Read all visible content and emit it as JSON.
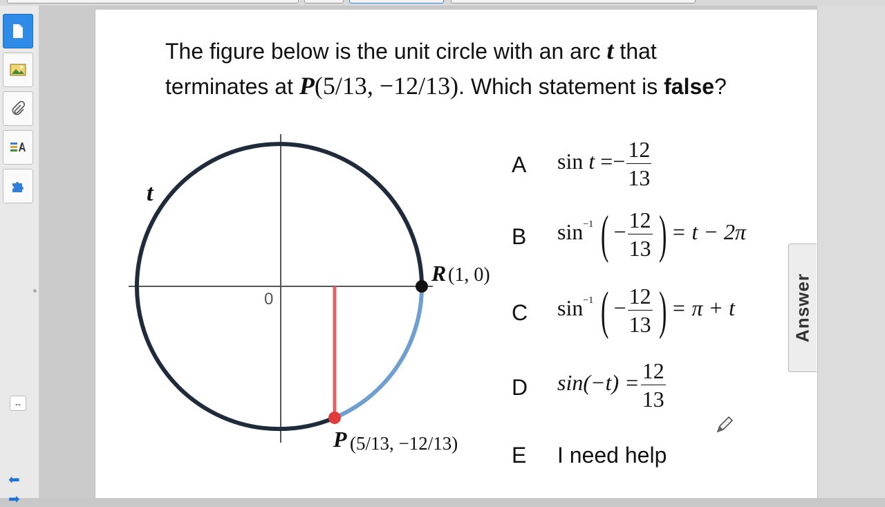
{
  "question": {
    "part1": "The figure below is the unit circle with an arc ",
    "arc_var": "t",
    "part2": " that",
    "part3": "terminates at ",
    "point_var": "P",
    "point_coords": "(5/13, −12/13)",
    "part4": ". Which statement is ",
    "keyword": "false",
    "part5": "?"
  },
  "figure": {
    "origin_label": "0",
    "arc_label": "t",
    "r_var": "R",
    "r_coords": "(1, 0)",
    "p_var": "P",
    "p_coords": "(5/13, −12/13)",
    "colors": {
      "circle": "#1f2a3a",
      "arc": "#6f9fd0",
      "segment": "#e06464",
      "point_r": "#111111",
      "point_p": "#e03c3c"
    }
  },
  "choices": [
    {
      "letter": "A",
      "lhs": "sin",
      "var": "t",
      "eq": "=−",
      "num": "12",
      "den": "13"
    },
    {
      "letter": "B",
      "fn": "sin",
      "inv": "−1",
      "sign": "−",
      "num": "12",
      "den": "13",
      "rhs": "= t − 2π"
    },
    {
      "letter": "C",
      "fn": "sin",
      "inv": "−1",
      "sign": "−",
      "num": "12",
      "den": "13",
      "rhs": "= π + t"
    },
    {
      "letter": "D",
      "lhs": "sin(−t) =",
      "num": "12",
      "den": "13"
    },
    {
      "letter": "E",
      "text": "I need help"
    }
  ],
  "answer_tab": "Answer",
  "icons": [
    "page-icon",
    "image-icon",
    "paperclip-icon",
    "text-tool-icon",
    "puzzle-icon",
    "expand-icon",
    "back-arrow-icon",
    "forward-arrow-icon",
    "pencil-icon"
  ]
}
